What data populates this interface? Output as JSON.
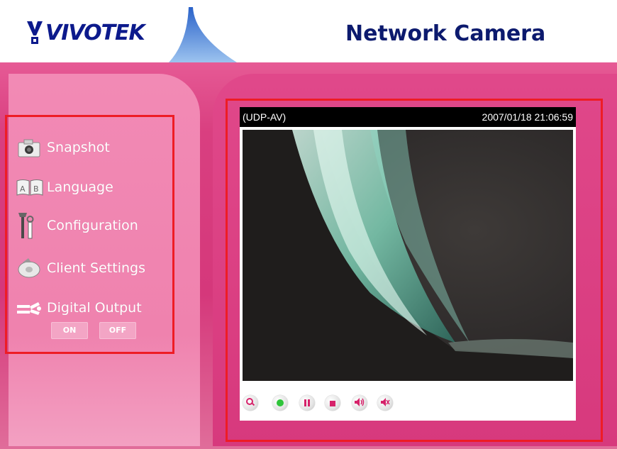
{
  "header": {
    "brand": "VIVOTEK",
    "title": "Network Camera"
  },
  "menu": {
    "items": [
      {
        "label": "Snapshot",
        "icon": "camera-icon"
      },
      {
        "label": "Language",
        "icon": "language-icon"
      },
      {
        "label": "Configuration",
        "icon": "tools-icon"
      },
      {
        "label": "Client Settings",
        "icon": "disc-icon"
      },
      {
        "label": "Digital Output",
        "icon": "switch-icon"
      }
    ],
    "digital_output": {
      "on_label": "ON",
      "off_label": "OFF"
    }
  },
  "video": {
    "mode": "(UDP-AV)",
    "timestamp": "2007/01/18 21:06:59"
  },
  "controls": [
    {
      "name": "zoom-button",
      "icon": "zoom-icon"
    },
    {
      "name": "play-button",
      "icon": "play-icon"
    },
    {
      "name": "pause-button",
      "icon": "pause-icon"
    },
    {
      "name": "stop-button",
      "icon": "stop-icon"
    },
    {
      "name": "talk-button",
      "icon": "speaker-icon"
    },
    {
      "name": "mute-button",
      "icon": "mute-icon"
    }
  ],
  "colors": {
    "brand_blue": "#0c1a8c",
    "pink_bg": "#d5387b",
    "highlight_red": "#ee1c25"
  }
}
